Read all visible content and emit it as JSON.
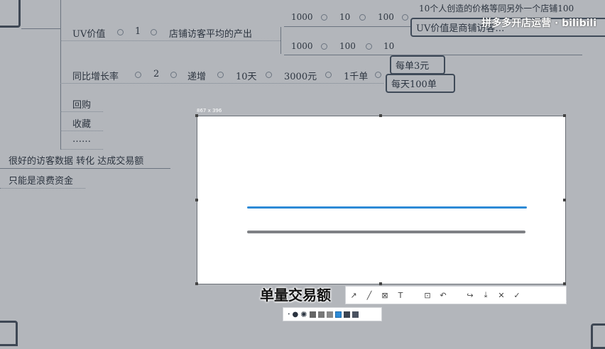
{
  "mindmap": {
    "uv": {
      "label": "UV价值",
      "num": "1",
      "desc": "店铺访客平均的产出"
    },
    "row_top": {
      "a": "1000",
      "b": "10",
      "c": "100"
    },
    "row_bottom": {
      "a": "1000",
      "b": "100",
      "c": "10"
    },
    "note1": "10个人创造的价格等同另外一个店铺100",
    "note2": "UV价值是商铺访客…",
    "growth": {
      "label": "同比增长率",
      "num": "2",
      "trend": "递增",
      "days": "10天",
      "amount": "3000元",
      "orders": "1千单"
    },
    "box1": "每单3元",
    "box2": "每天100单",
    "items": [
      "回购",
      "收藏",
      "……"
    ],
    "bottom1": "很好的访客数据 转化 达成交易额",
    "bottom2": "只能是浪费资金"
  },
  "watermark": "拼多多开店运营 · bilibili",
  "screenshot_tool": {
    "size_label": "867 x 396",
    "caption": "单量交易额",
    "tools": [
      "arrow-icon",
      "pen-icon",
      "mosaic-icon",
      "text-icon",
      "pin-icon",
      "undo-icon",
      "share-icon",
      "save-icon",
      "close-icon",
      "confirm-icon"
    ]
  },
  "colors": {
    "accent": "#2d8ad6",
    "background": "#b3b6bb"
  }
}
